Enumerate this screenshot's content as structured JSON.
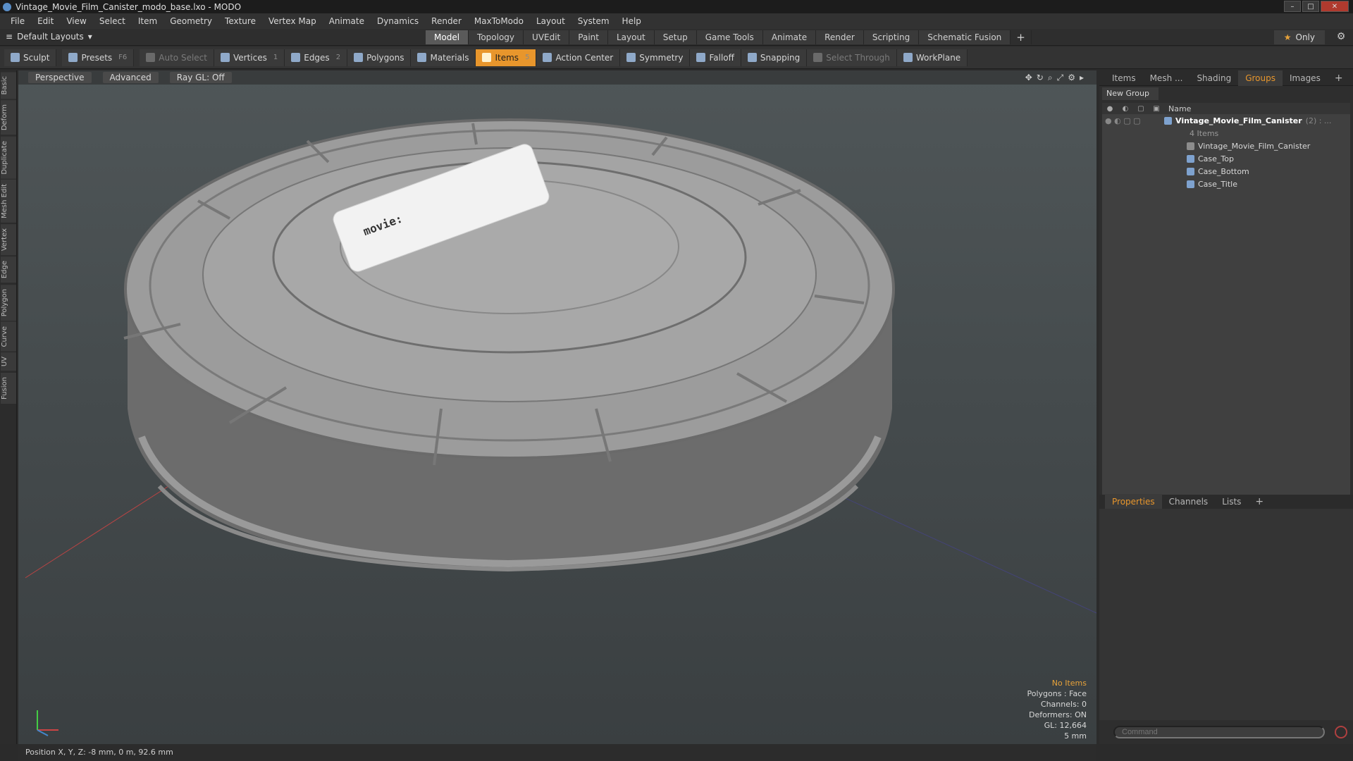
{
  "window": {
    "title": "Vintage_Movie_Film_Canister_modo_base.lxo - MODO"
  },
  "menu": [
    "File",
    "Edit",
    "View",
    "Select",
    "Item",
    "Geometry",
    "Texture",
    "Vertex Map",
    "Animate",
    "Dynamics",
    "Render",
    "MaxToModo",
    "Layout",
    "System",
    "Help"
  ],
  "layout_select": "Default Layouts",
  "layout_tabs": [
    "Model",
    "Topology",
    "UVEdit",
    "Paint",
    "Layout",
    "Setup",
    "Game Tools",
    "Animate",
    "Render",
    "Scripting",
    "Schematic Fusion"
  ],
  "active_layout_tab": "Model",
  "only_label": "Only",
  "toolbar": {
    "sculpt": "Sculpt",
    "presets": "Presets",
    "presets_key": "F6",
    "auto_select": "Auto Select",
    "vertices": "Vertices",
    "vertices_key": "1",
    "edges": "Edges",
    "edges_key": "2",
    "polygons": "Polygons",
    "materials": "Materials",
    "items": "Items",
    "items_key": "5",
    "action_center": "Action Center",
    "symmetry": "Symmetry",
    "falloff": "Falloff",
    "snapping": "Snapping",
    "select_through": "Select Through",
    "workplane": "WorkPlane"
  },
  "left_tabs": [
    "Basic",
    "Deform",
    "Duplicate",
    "Mesh Edit",
    "Vertex",
    "Edge",
    "Polygon",
    "Curve",
    "UV",
    "Fusion"
  ],
  "viewport": {
    "mode": "Perspective",
    "advanced": "Advanced",
    "raygl": "Ray GL: Off",
    "texture_text": "movie:"
  },
  "viewport_info": {
    "no_items": "No Items",
    "polygons": "Polygons : Face",
    "channels": "Channels: 0",
    "deformers": "Deformers: ON",
    "gl": "GL: 12,664",
    "unit": "5 mm"
  },
  "status": "Position X, Y, Z:  -8 mm, 0 m, 92.6 mm",
  "right_tabs": [
    "Items",
    "Mesh ...",
    "Shading",
    "Groups",
    "Images"
  ],
  "active_right_tab": "Groups",
  "new_group": "New Group",
  "tree": {
    "name_header": "Name",
    "group": "Vintage_Movie_Film_Canister",
    "group_count": "(2) : ...",
    "group_sub": "4 Items",
    "children": [
      "Vintage_Movie_Film_Canister",
      "Case_Top",
      "Case_Bottom",
      "Case_Title"
    ]
  },
  "prop_tabs": [
    "Properties",
    "Channels",
    "Lists"
  ],
  "active_prop_tab": "Properties",
  "command_placeholder": "Command",
  "colors": {
    "accent": "#e8962c",
    "viewport_bg": "#474d4f"
  }
}
